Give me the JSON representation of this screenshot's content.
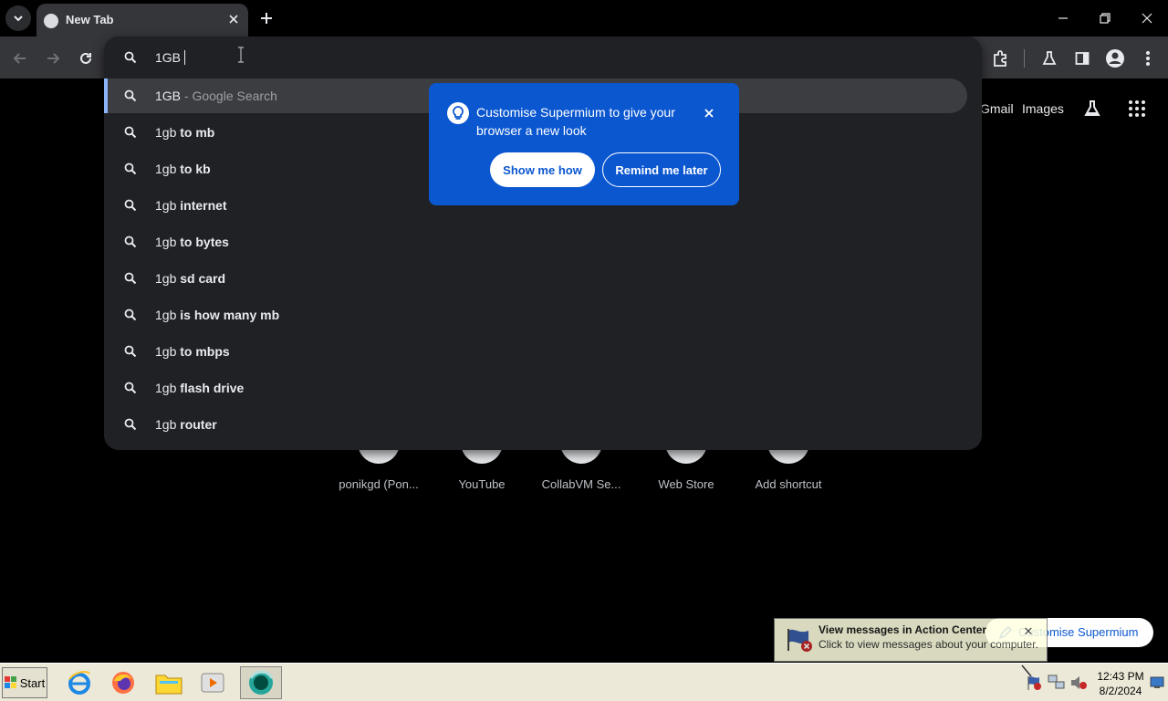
{
  "tab": {
    "title": "New Tab",
    "close_icon": "close-icon"
  },
  "omnibox": {
    "query": "1GB",
    "suggestions": [
      {
        "prefix": "1GB",
        "rest": " - Google Search",
        "style": "dim"
      },
      {
        "prefix": "1gb",
        "rest": " to mb",
        "style": "bold"
      },
      {
        "prefix": "1gb",
        "rest": " to kb",
        "style": "bold"
      },
      {
        "prefix": "1gb",
        "rest": " internet",
        "style": "bold"
      },
      {
        "prefix": "1gb",
        "rest": " to bytes",
        "style": "bold"
      },
      {
        "prefix": "1gb",
        "rest": " sd card",
        "style": "bold"
      },
      {
        "prefix": "1gb",
        "rest": " is how many mb",
        "style": "bold"
      },
      {
        "prefix": "1gb",
        "rest": " to mbps",
        "style": "bold"
      },
      {
        "prefix": "1gb",
        "rest": " flash drive",
        "style": "bold"
      },
      {
        "prefix": "1gb",
        "rest": " router",
        "style": "bold"
      }
    ]
  },
  "ntp": {
    "links": {
      "gmail": "Gmail",
      "images": "Images"
    },
    "shortcuts": [
      "ponikgd (Pon...",
      "YouTube",
      "CollabVM Se...",
      "Web Store",
      "Add shortcut"
    ]
  },
  "promo": {
    "text": "Customise Supermium to give your browser a new look",
    "show_label": "Show me how",
    "later_label": "Remind me later"
  },
  "customise_chip": {
    "label": "Customise Supermium"
  },
  "balloon": {
    "title": "View messages in Action Center",
    "body": "Click to view messages about your computer."
  },
  "taskbar": {
    "start_label": "Start",
    "time": "12:43 PM",
    "date": "8/2/2024"
  },
  "colors": {
    "accent": "#0b57d0",
    "omnibox_bg": "#202124",
    "toolbar_bg": "#35363a",
    "selected_indicator": "#8ab4f8"
  }
}
